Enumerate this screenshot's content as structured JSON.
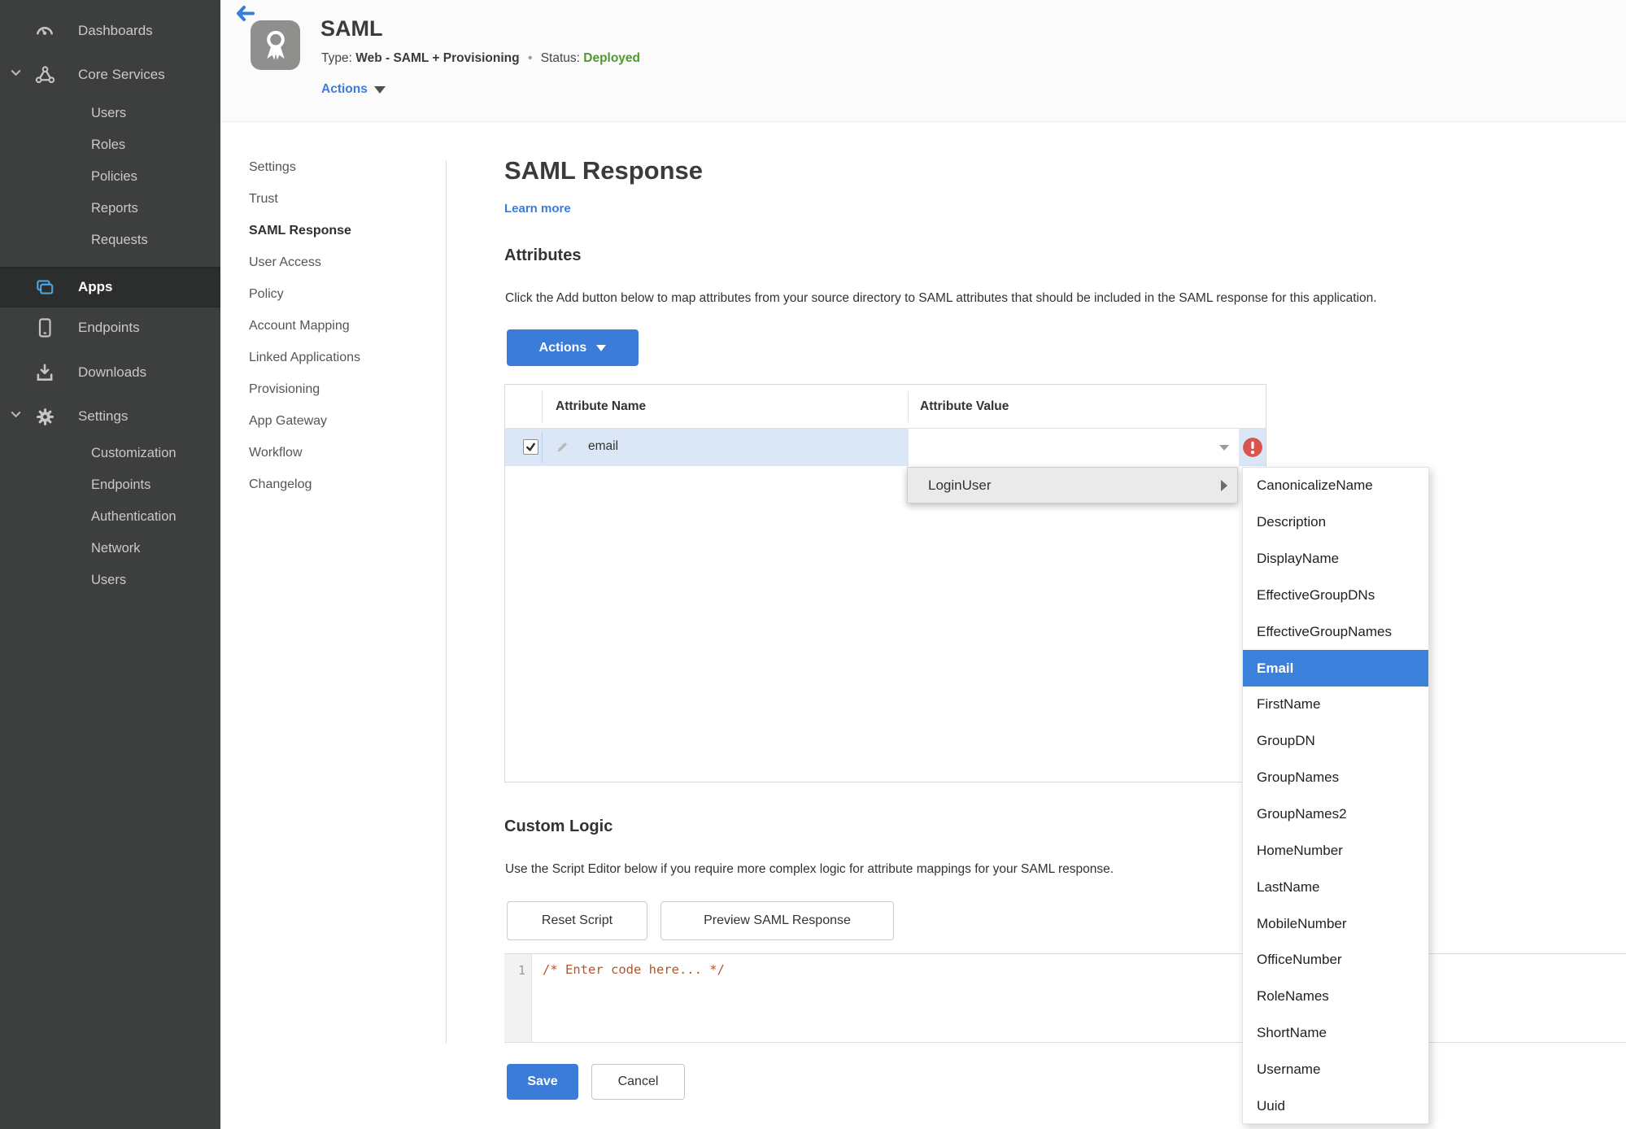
{
  "sidebar": {
    "items": [
      {
        "label": "Dashboards",
        "icon": "gauge-icon"
      },
      {
        "label": "Core Services",
        "icon": "core-services-icon",
        "expanded": true,
        "children": [
          "Users",
          "Roles",
          "Policies",
          "Reports",
          "Requests"
        ]
      },
      {
        "label": "Apps",
        "icon": "apps-icon",
        "active": true
      },
      {
        "label": "Endpoints",
        "icon": "device-icon"
      },
      {
        "label": "Downloads",
        "icon": "download-icon"
      },
      {
        "label": "Settings",
        "icon": "gear-icon",
        "expanded": true,
        "children": [
          "Customization",
          "Endpoints",
          "Authentication",
          "Network",
          "Users"
        ]
      }
    ]
  },
  "header": {
    "title": "SAML",
    "type_label": "Type:",
    "type_value": "Web - SAML + Provisioning",
    "separator": "•",
    "status_label": "Status:",
    "status_value": "Deployed",
    "actions_label": "Actions"
  },
  "subnav": {
    "active": "SAML Response",
    "items": [
      "Settings",
      "Trust",
      "SAML Response",
      "User Access",
      "Policy",
      "Account Mapping",
      "Linked Applications",
      "Provisioning",
      "App Gateway",
      "Workflow",
      "Changelog"
    ]
  },
  "main": {
    "title": "SAML Response",
    "learn_more": "Learn more",
    "attributes": {
      "heading": "Attributes",
      "description": "Click the Add button below to map attributes from your source directory to SAML attributes that should be included in the SAML response for this application.",
      "actions_button": "Actions",
      "table": {
        "columns": [
          "Attribute Name",
          "Attribute Value"
        ],
        "rows": [
          {
            "name": "email",
            "value": "",
            "checked": true,
            "error": true
          }
        ]
      }
    },
    "dropdown": {
      "parent_item": "LoginUser",
      "selected_item": "Email",
      "submenu_items": [
        "CanonicalizeName",
        "Description",
        "DisplayName",
        "EffectiveGroupDNs",
        "EffectiveGroupNames",
        "Email",
        "FirstName",
        "GroupDN",
        "GroupNames",
        "GroupNames2",
        "HomeNumber",
        "LastName",
        "MobileNumber",
        "OfficeNumber",
        "RoleNames",
        "ShortName",
        "Username",
        "Uuid"
      ]
    },
    "custom_logic": {
      "heading": "Custom Logic",
      "description": "Use the Script Editor below if you require more complex logic for attribute mappings for your SAML response.",
      "reset_button": "Reset Script",
      "preview_button": "Preview SAML Response",
      "editor": {
        "line_number": "1",
        "code": "/* Enter code here... */"
      }
    },
    "footer": {
      "save_button": "Save",
      "cancel_button": "Cancel"
    }
  },
  "colors": {
    "accent_blue": "#3a7cd8",
    "selection_blue": "#3b80da",
    "status_green": "#4e9a2e",
    "error_red": "#d9534f",
    "row_highlight": "#dbe7f7",
    "sidebar_bg": "#3d3e3e",
    "sidebar_active_bg": "#2c2d2d",
    "code_comment": "#b2562c"
  }
}
